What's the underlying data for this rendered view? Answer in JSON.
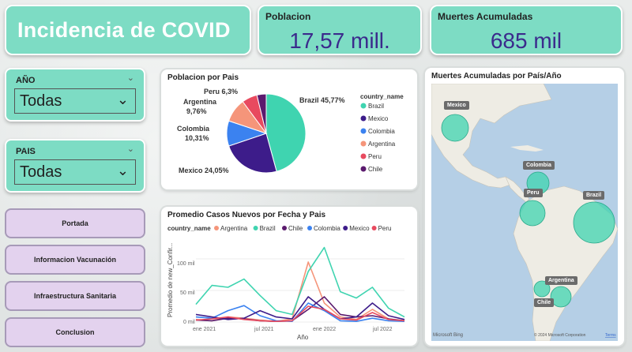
{
  "header": {
    "title": "Incidencia de COVID"
  },
  "kpis": {
    "poblacion": {
      "label": "Poblacion",
      "value": "17,57 mill."
    },
    "muertes": {
      "label": "Muertes Acumuladas",
      "value": "685 mil"
    }
  },
  "slicers": {
    "anio": {
      "label": "AÑO",
      "value": "Todas"
    },
    "pais": {
      "label": "PAIS",
      "value": "Todas"
    }
  },
  "nav": [
    "Portada",
    "Informacion Vacunación",
    "Infraestructura Sanitaria",
    "Conclusion"
  ],
  "pie": {
    "title": "Poblacion por Pais",
    "legend_title": "country_name",
    "slice_labels": [
      "Brazil 45,77%",
      "Mexico 24,05%",
      "Colombia",
      "10,31%",
      "Argentina",
      "9,76%",
      "Peru 6,3%"
    ],
    "legend": [
      {
        "name": "Brazil",
        "color": "#3fd4b0"
      },
      {
        "name": "Mexico",
        "color": "#3d1c8a"
      },
      {
        "name": "Colombia",
        "color": "#3b82f0"
      },
      {
        "name": "Argentina",
        "color": "#f5957a"
      },
      {
        "name": "Peru",
        "color": "#e84a5f"
      },
      {
        "name": "Chile",
        "color": "#5b1a6e"
      }
    ]
  },
  "line": {
    "title": "Promedio Casos Nuevos por Fecha y Pais",
    "legend_title": "country_name",
    "ylabel": "Promedio de new_Confir...",
    "xlabel": "Año",
    "yticks": [
      "100 mil",
      "50 mil",
      "0 mil"
    ],
    "xticks": [
      "ene 2021",
      "jul 2021",
      "ene 2022",
      "jul 2022"
    ]
  },
  "map": {
    "title": "Muertes Acumuladas por País/Año",
    "country_labels": [
      "Mexico",
      "Colombia",
      "Peru",
      "Brazil",
      "Argentina",
      "Chile"
    ],
    "attribution_left": "Microsoft Bing",
    "attribution_right": "© 2024 Microsoft Corporation",
    "attribution_terms": "Terms"
  },
  "chart_data": [
    {
      "type": "pie",
      "title": "Poblacion por Pais",
      "legend_title": "country_name",
      "categories": [
        "Brazil",
        "Mexico",
        "Colombia",
        "Argentina",
        "Peru",
        "Chile"
      ],
      "values": [
        45.77,
        24.05,
        10.31,
        9.76,
        6.3,
        3.81
      ],
      "colors": [
        "#3fd4b0",
        "#3d1c8a",
        "#3b82f0",
        "#f5957a",
        "#e84a5f",
        "#5b1a6e"
      ],
      "legend": "right"
    },
    {
      "type": "line",
      "title": "Promedio Casos Nuevos por Fecha y Pais",
      "xlabel": "Año",
      "ylabel": "Promedio de new_Confir...",
      "x": [
        "2020-12",
        "2021-02",
        "2021-04",
        "2021-06",
        "2021-08",
        "2021-10",
        "2021-12",
        "2022-01",
        "2022-02",
        "2022-03",
        "2022-05",
        "2022-07",
        "2022-09",
        "2022-11"
      ],
      "ylim": [
        0,
        120000
      ],
      "series": [
        {
          "name": "Argentina",
          "color": "#f5957a",
          "values": [
            4000,
            2000,
            8000,
            6000,
            3000,
            1000,
            5000,
            95000,
            30000,
            8000,
            4000,
            20000,
            5000,
            2000
          ]
        },
        {
          "name": "Brazil",
          "color": "#3fd4b0",
          "values": [
            28000,
            58000,
            55000,
            68000,
            42000,
            18000,
            12000,
            80000,
            118000,
            48000,
            38000,
            55000,
            22000,
            8000
          ]
        },
        {
          "name": "Chile",
          "color": "#5b1a6e",
          "values": [
            3000,
            2000,
            6000,
            5000,
            2000,
            1000,
            2000,
            20000,
            40000,
            12000,
            8000,
            10000,
            5000,
            2000
          ]
        },
        {
          "name": "Colombia",
          "color": "#3b82f0",
          "values": [
            8000,
            6000,
            18000,
            26000,
            10000,
            2000,
            1000,
            30000,
            18000,
            2000,
            1000,
            6000,
            2000,
            1000
          ]
        },
        {
          "name": "Mexico",
          "color": "#3d1c8a",
          "values": [
            12000,
            8000,
            4000,
            6000,
            18000,
            8000,
            5000,
            40000,
            20000,
            5000,
            8000,
            30000,
            10000,
            4000
          ]
        },
        {
          "name": "Peru",
          "color": "#e84a5f",
          "values": [
            3000,
            5000,
            8000,
            4000,
            2000,
            1000,
            2000,
            25000,
            20000,
            5000,
            3000,
            15000,
            4000,
            2000
          ]
        }
      ],
      "legend": "top"
    }
  ]
}
